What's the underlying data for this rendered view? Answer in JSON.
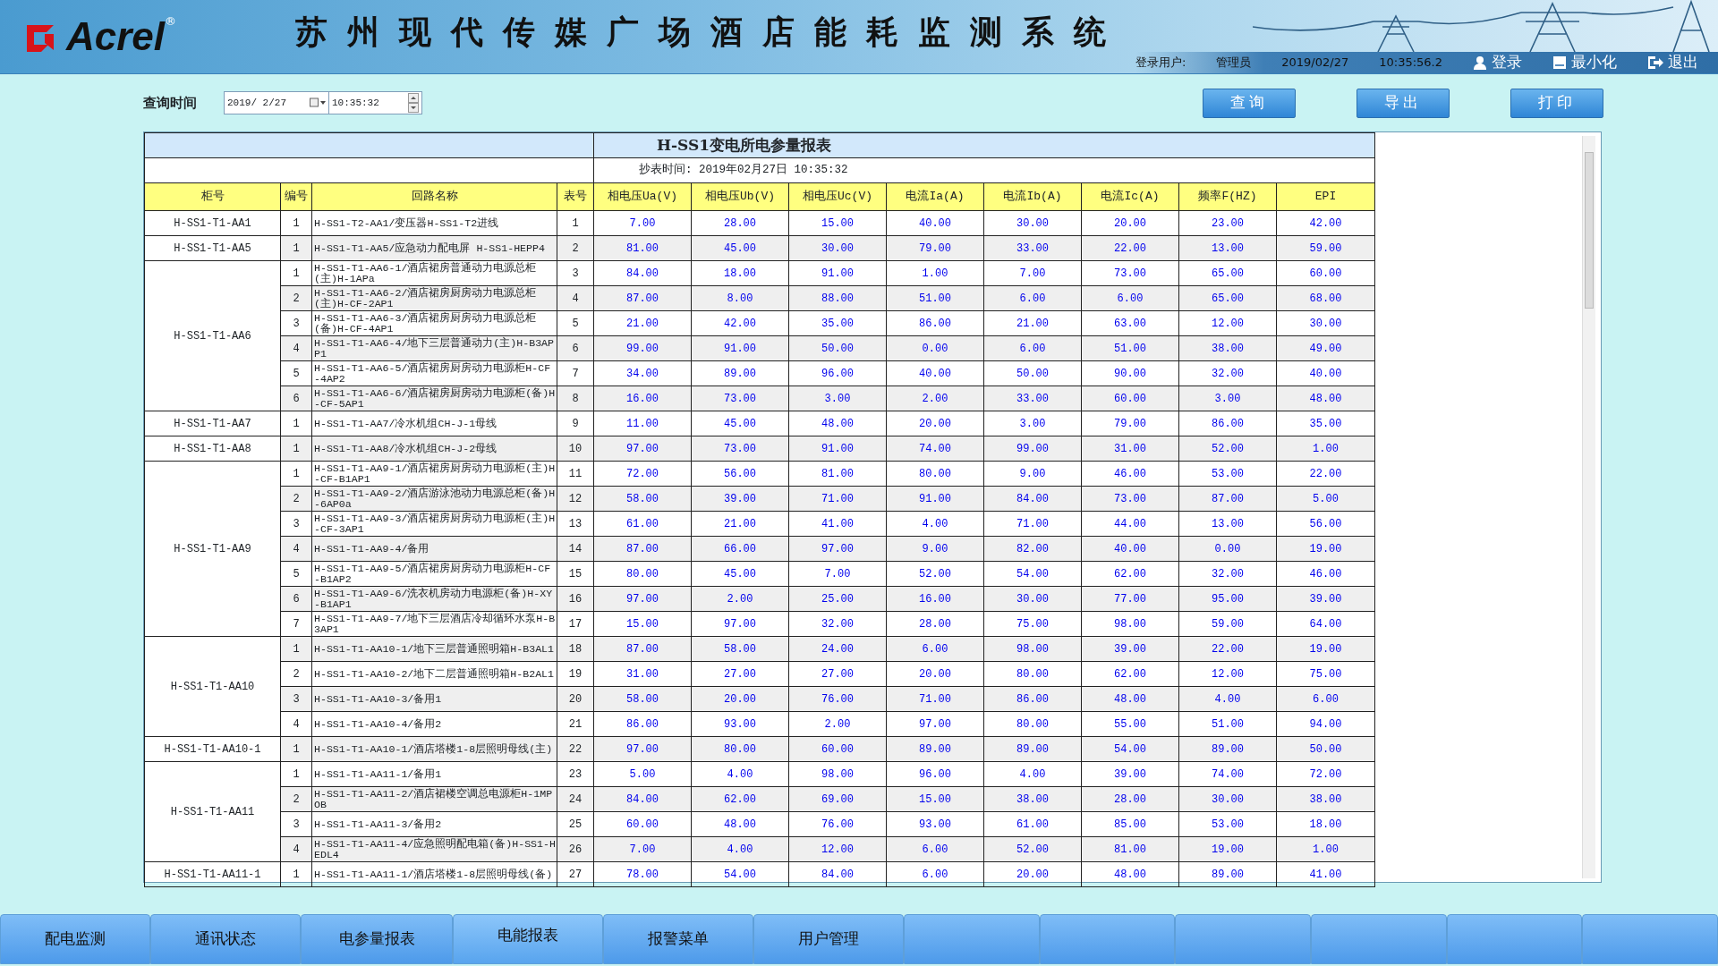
{
  "header": {
    "logo": "Acrel",
    "logo_mark": "®",
    "title": "苏州现代传媒广场酒店能耗监测系统",
    "user_label": "登录用户:",
    "user": "管理员",
    "date": "2019/02/27",
    "time": "10:35:56.2",
    "actions": [
      {
        "label": "登录",
        "kind": "login"
      },
      {
        "label": "最小化",
        "kind": "minimize"
      },
      {
        "label": "退出",
        "kind": "exit"
      }
    ]
  },
  "query": {
    "label": "查询时间",
    "date": "2019/ 2/27",
    "time": "10:35:32",
    "buttons": [
      "查询",
      "导出",
      "打印"
    ]
  },
  "report": {
    "title": "H-SS1变电所电参量报表",
    "subtitle": "抄表时间: 2019年02月27日 10:35:32",
    "columns": [
      "柜号",
      "编号",
      "回路名称",
      "表号",
      "相电压Ua(V)",
      "相电压Ub(V)",
      "相电压Uc(V)",
      "电流Ia(A)",
      "电流Ib(A)",
      "电流Ic(A)",
      "频率F(HZ)",
      "EPI"
    ],
    "groups": [
      {
        "cabinet": "H-SS1-T1-AA1",
        "rows": [
          {
            "no": "1",
            "name": "H-SS1-T2-AA1/变压器H-SS1-T2进线",
            "meter": "1",
            "values": [
              "7.00",
              "28.00",
              "15.00",
              "40.00",
              "30.00",
              "20.00",
              "23.00",
              "42.00"
            ]
          }
        ]
      },
      {
        "cabinet": "H-SS1-T1-AA5",
        "rows": [
          {
            "no": "1",
            "name": "H-SS1-T1-AA5/应急动力配电屏 H-SS1-HEPP4",
            "meter": "2",
            "values": [
              "81.00",
              "45.00",
              "30.00",
              "79.00",
              "33.00",
              "22.00",
              "13.00",
              "59.00"
            ]
          }
        ]
      },
      {
        "cabinet": "H-SS1-T1-AA6",
        "rows": [
          {
            "no": "1",
            "name": "H-SS1-T1-AA6-1/酒店裙房普通动力电源总柜(主)H-1APa",
            "meter": "3",
            "values": [
              "84.00",
              "18.00",
              "91.00",
              "1.00",
              "7.00",
              "73.00",
              "65.00",
              "60.00"
            ]
          },
          {
            "no": "2",
            "name": "H-SS1-T1-AA6-2/酒店裙房厨房动力电源总柜(主)H-CF-2AP1",
            "meter": "4",
            "values": [
              "87.00",
              "8.00",
              "88.00",
              "51.00",
              "6.00",
              "6.00",
              "65.00",
              "68.00"
            ]
          },
          {
            "no": "3",
            "name": "H-SS1-T1-AA6-3/酒店裙房厨房动力电源总柜(备)H-CF-4AP1",
            "meter": "5",
            "values": [
              "21.00",
              "42.00",
              "35.00",
              "86.00",
              "21.00",
              "63.00",
              "12.00",
              "30.00"
            ]
          },
          {
            "no": "4",
            "name": "H-SS1-T1-AA6-4/地下三层普通动力(主)H-B3APP1",
            "meter": "6",
            "values": [
              "99.00",
              "91.00",
              "50.00",
              "0.00",
              "6.00",
              "51.00",
              "38.00",
              "49.00"
            ]
          },
          {
            "no": "5",
            "name": "H-SS1-T1-AA6-5/酒店裙房厨房动力电源柜H-CF-4AP2",
            "meter": "7",
            "values": [
              "34.00",
              "89.00",
              "96.00",
              "40.00",
              "50.00",
              "90.00",
              "32.00",
              "40.00"
            ]
          },
          {
            "no": "6",
            "name": "H-SS1-T1-AA6-6/酒店裙房厨房动力电源柜(备)H-CF-5AP1",
            "meter": "8",
            "values": [
              "16.00",
              "73.00",
              "3.00",
              "2.00",
              "33.00",
              "60.00",
              "3.00",
              "48.00"
            ]
          }
        ]
      },
      {
        "cabinet": "H-SS1-T1-AA7",
        "rows": [
          {
            "no": "1",
            "name": "H-SS1-T1-AA7/冷水机组CH-J-1母线",
            "meter": "9",
            "values": [
              "11.00",
              "45.00",
              "48.00",
              "20.00",
              "3.00",
              "79.00",
              "86.00",
              "35.00"
            ]
          }
        ]
      },
      {
        "cabinet": "H-SS1-T1-AA8",
        "rows": [
          {
            "no": "1",
            "name": "H-SS1-T1-AA8/冷水机组CH-J-2母线",
            "meter": "10",
            "values": [
              "97.00",
              "73.00",
              "91.00",
              "74.00",
              "99.00",
              "31.00",
              "52.00",
              "1.00"
            ]
          }
        ]
      },
      {
        "cabinet": "H-SS1-T1-AA9",
        "rows": [
          {
            "no": "1",
            "name": "H-SS1-T1-AA9-1/酒店裙房厨房动力电源柜(主)H-CF-B1AP1",
            "meter": "11",
            "values": [
              "72.00",
              "56.00",
              "81.00",
              "80.00",
              "9.00",
              "46.00",
              "53.00",
              "22.00"
            ]
          },
          {
            "no": "2",
            "name": "H-SS1-T1-AA9-2/酒店游泳池动力电源总柜(备)H-6AP0a",
            "meter": "12",
            "values": [
              "58.00",
              "39.00",
              "71.00",
              "91.00",
              "84.00",
              "73.00",
              "87.00",
              "5.00"
            ]
          },
          {
            "no": "3",
            "name": "H-SS1-T1-AA9-3/酒店裙房厨房动力电源柜(主)H-CF-3AP1",
            "meter": "13",
            "values": [
              "61.00",
              "21.00",
              "41.00",
              "4.00",
              "71.00",
              "44.00",
              "13.00",
              "56.00"
            ]
          },
          {
            "no": "4",
            "name": "H-SS1-T1-AA9-4/备用",
            "meter": "14",
            "values": [
              "87.00",
              "66.00",
              "97.00",
              "9.00",
              "82.00",
              "40.00",
              "0.00",
              "19.00"
            ]
          },
          {
            "no": "5",
            "name": "H-SS1-T1-AA9-5/酒店裙房厨房动力电源柜H-CF-B1AP2",
            "meter": "15",
            "values": [
              "80.00",
              "45.00",
              "7.00",
              "52.00",
              "54.00",
              "62.00",
              "32.00",
              "46.00"
            ]
          },
          {
            "no": "6",
            "name": "H-SS1-T1-AA9-6/洗衣机房动力电源柜(备)H-XY-B1AP1",
            "meter": "16",
            "values": [
              "97.00",
              "2.00",
              "25.00",
              "16.00",
              "30.00",
              "77.00",
              "95.00",
              "39.00"
            ]
          },
          {
            "no": "7",
            "name": "H-SS1-T1-AA9-7/地下三层酒店冷却循环水泵H-B3AP1",
            "meter": "17",
            "values": [
              "15.00",
              "97.00",
              "32.00",
              "28.00",
              "75.00",
              "98.00",
              "59.00",
              "64.00"
            ]
          }
        ]
      },
      {
        "cabinet": "H-SS1-T1-AA10",
        "rows": [
          {
            "no": "1",
            "name": "H-SS1-T1-AA10-1/地下三层普通照明箱H-B3AL1",
            "meter": "18",
            "values": [
              "87.00",
              "58.00",
              "24.00",
              "6.00",
              "98.00",
              "39.00",
              "22.00",
              "19.00"
            ]
          },
          {
            "no": "2",
            "name": "H-SS1-T1-AA10-2/地下二层普通照明箱H-B2AL1",
            "meter": "19",
            "values": [
              "31.00",
              "27.00",
              "27.00",
              "20.00",
              "80.00",
              "62.00",
              "12.00",
              "75.00"
            ]
          },
          {
            "no": "3",
            "name": "H-SS1-T1-AA10-3/备用1",
            "meter": "20",
            "values": [
              "58.00",
              "20.00",
              "76.00",
              "71.00",
              "86.00",
              "48.00",
              "4.00",
              "6.00"
            ]
          },
          {
            "no": "4",
            "name": "H-SS1-T1-AA10-4/备用2",
            "meter": "21",
            "values": [
              "86.00",
              "93.00",
              "2.00",
              "97.00",
              "80.00",
              "55.00",
              "51.00",
              "94.00"
            ]
          }
        ]
      },
      {
        "cabinet": "H-SS1-T1-AA10-1",
        "rows": [
          {
            "no": "1",
            "name": "H-SS1-T1-AA10-1/酒店塔楼1-8层照明母线(主)",
            "meter": "22",
            "values": [
              "97.00",
              "80.00",
              "60.00",
              "89.00",
              "89.00",
              "54.00",
              "89.00",
              "50.00"
            ]
          }
        ]
      },
      {
        "cabinet": "H-SS1-T1-AA11",
        "rows": [
          {
            "no": "1",
            "name": "H-SS1-T1-AA11-1/备用1",
            "meter": "23",
            "values": [
              "5.00",
              "4.00",
              "98.00",
              "96.00",
              "4.00",
              "39.00",
              "74.00",
              "72.00"
            ]
          },
          {
            "no": "2",
            "name": "H-SS1-T1-AA11-2/酒店裙楼空调总电源柜H-1MPOB",
            "meter": "24",
            "values": [
              "84.00",
              "62.00",
              "69.00",
              "15.00",
              "38.00",
              "28.00",
              "30.00",
              "38.00"
            ]
          },
          {
            "no": "3",
            "name": "H-SS1-T1-AA11-3/备用2",
            "meter": "25",
            "values": [
              "60.00",
              "48.00",
              "76.00",
              "93.00",
              "61.00",
              "85.00",
              "53.00",
              "18.00"
            ]
          },
          {
            "no": "4",
            "name": "H-SS1-T1-AA11-4/应急照明配电箱(备)H-SS1-HEDL4",
            "meter": "26",
            "values": [
              "7.00",
              "4.00",
              "12.00",
              "6.00",
              "52.00",
              "81.00",
              "19.00",
              "1.00"
            ]
          }
        ]
      },
      {
        "cabinet": "H-SS1-T1-AA11-1",
        "rows": [
          {
            "no": "1",
            "name": "H-SS1-T1-AA11-1/酒店塔楼1-8层照明母线(备)",
            "meter": "27",
            "values": [
              "78.00",
              "54.00",
              "84.00",
              "6.00",
              "20.00",
              "48.00",
              "89.00",
              "41.00"
            ]
          }
        ]
      }
    ]
  },
  "tabs": [
    {
      "label": "配电监测",
      "selected": false
    },
    {
      "label": "通讯状态",
      "selected": false
    },
    {
      "label": "电参量报表",
      "selected": false
    },
    {
      "label": "电能报表",
      "selected": true
    },
    {
      "label": "报警菜单",
      "selected": false
    },
    {
      "label": "用户管理",
      "selected": false
    }
  ]
}
